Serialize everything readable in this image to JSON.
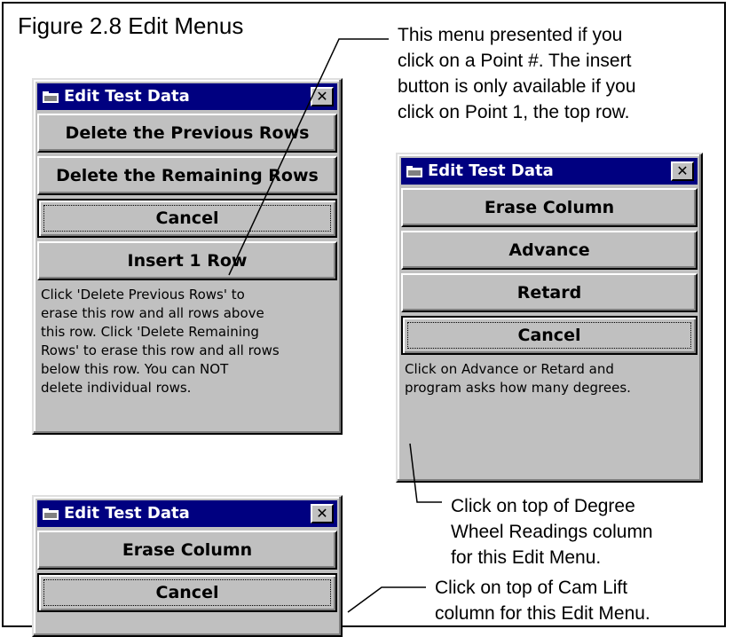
{
  "figure": {
    "title": "Figure 2.8  Edit Menus"
  },
  "notes": {
    "point_menu": [
      "This menu presented if you",
      "click on a Point #.  The insert",
      "button is only available if you",
      "click on Point 1, the top row."
    ],
    "degree_wheel": [
      "Click on top of Degree",
      "Wheel Readings column",
      "for this Edit Menu."
    ],
    "cam_lift": [
      "Click on top of Cam Lift",
      "column for this Edit Menu."
    ]
  },
  "dialog_point": {
    "title": "Edit Test Data",
    "close": "✕",
    "buttons": [
      "Delete the Previous Rows",
      "Delete the Remaining Rows",
      "Cancel",
      "Insert 1 Row"
    ],
    "help_lines": [
      "Click 'Delete Previous Rows' to",
      "erase this row and all rows above",
      "this row.  Click 'Delete Remaining",
      "Rows' to erase this row and all rows",
      "below this row.  You can NOT",
      "delete individual rows."
    ]
  },
  "dialog_degree": {
    "title": "Edit Test Data",
    "close": "✕",
    "buttons": [
      "Erase Column",
      "Advance",
      "Retard",
      "Cancel"
    ],
    "help_lines": [
      "Click on Advance or Retard and",
      "program asks how many degrees."
    ]
  },
  "dialog_cam": {
    "title": "Edit Test Data",
    "close": "✕",
    "buttons": [
      "Erase Column",
      "Cancel"
    ]
  },
  "colors": {
    "titlebar": "#000080",
    "face": "#c0c0c0"
  }
}
